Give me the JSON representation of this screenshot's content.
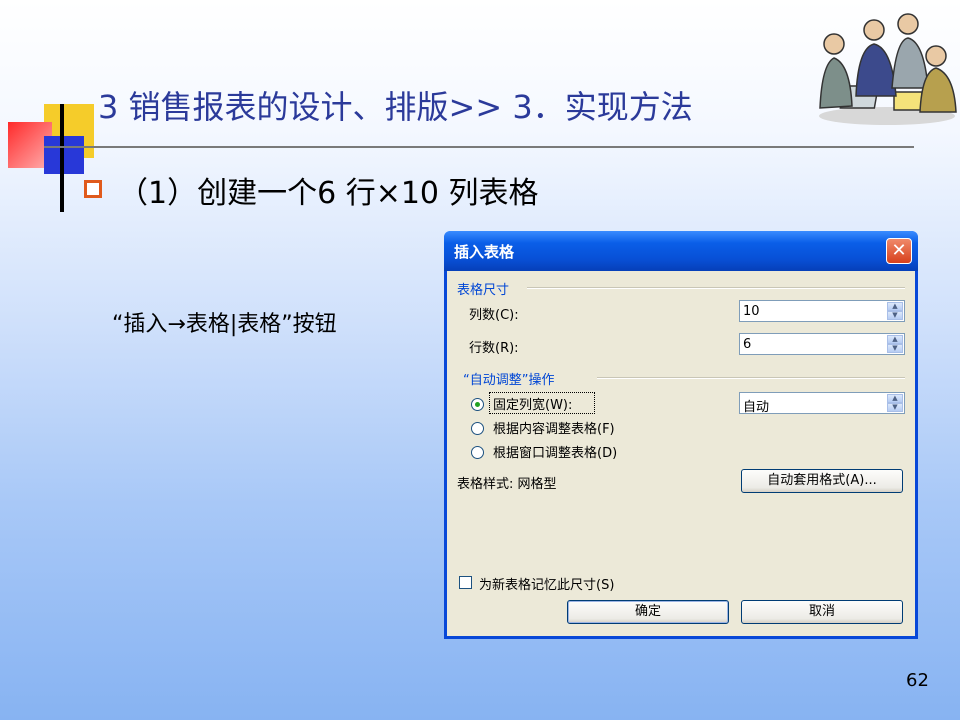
{
  "slide": {
    "title": "3 销售报表的设计、排版>> 3．实现方法",
    "bullet": "（1）创建一个6 行×10 列表格",
    "caption": "“插入→表格|表格”按钮",
    "page_number": "62"
  },
  "dialog": {
    "title": "插入表格",
    "close_glyph": "✕",
    "size_group": {
      "label": "表格尺寸",
      "columns_label": "列数(C):",
      "columns_value": "10",
      "rows_label": "行数(R):",
      "rows_value": "6"
    },
    "autofit_group": {
      "label": "“自动调整”操作",
      "fixed_width_label": "固定列宽(W):",
      "fixed_width_value": "自动",
      "fit_contents_label": "根据内容调整表格(F)",
      "fit_window_label": "根据窗口调整表格(D)",
      "selected": "fixed_width"
    },
    "style_label": "表格样式: 网格型",
    "autoformat_button": "自动套用格式(A)...",
    "remember_label": "为新表格记忆此尺寸(S)",
    "remember_checked": false,
    "ok_button": "确定",
    "cancel_button": "取消"
  },
  "icons": {
    "spin_up": "▲",
    "spin_down": "▼"
  },
  "colors": {
    "title": "#2b3a9a",
    "bullet": "#e05a1c",
    "dialog_frame": "#0848d8",
    "dialog_face": "#ece9d8"
  }
}
